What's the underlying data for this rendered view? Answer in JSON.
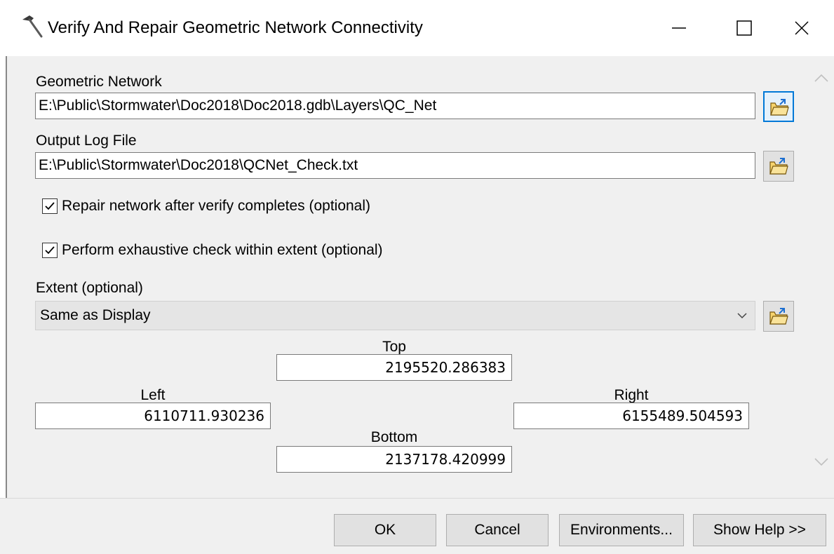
{
  "window": {
    "title": "Verify And Repair Geometric Network Connectivity",
    "minimize_icon": "minimize-icon",
    "maximize_icon": "maximize-icon",
    "close_icon": "close-icon"
  },
  "form": {
    "geometric_network": {
      "label": "Geometric Network",
      "value": "E:\\Public\\Stormwater\\Doc2018\\Doc2018.gdb\\Layers\\QC_Net"
    },
    "output_log_file": {
      "label": "Output Log File",
      "value": "E:\\Public\\Stormwater\\Doc2018\\QCNet_Check.txt"
    },
    "repair_network": {
      "label": "Repair network after verify completes (optional)",
      "checked": true
    },
    "exhaustive_check": {
      "label": "Perform exhaustive check within extent (optional)",
      "checked": true
    },
    "extent": {
      "label": "Extent (optional)",
      "selected": "Same as Display",
      "top_label": "Top",
      "top_value": "2195520.286383",
      "left_label": "Left",
      "left_value": "6110711.930236",
      "right_label": "Right",
      "right_value": "6155489.504593",
      "bottom_label": "Bottom",
      "bottom_value": "2137178.420999"
    }
  },
  "buttons": {
    "ok": "OK",
    "cancel": "Cancel",
    "environments": "Environments...",
    "show_help": "Show Help >>"
  },
  "colors": {
    "focus": "#0078d7",
    "button_bg": "#e1e1e1",
    "dialog_bg": "#f0f0f0"
  }
}
